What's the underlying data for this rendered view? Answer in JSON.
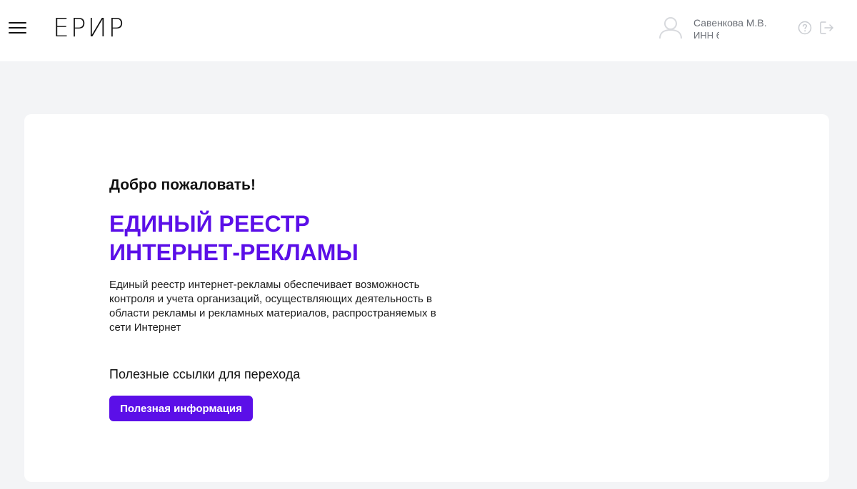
{
  "header": {
    "logo": "ЕРИР",
    "user": {
      "name": "Савенкова М.В.",
      "inn": "ИНН 6"
    },
    "icons": {
      "menu": "menu-icon",
      "avatar": "user-avatar-icon",
      "help": "help-circle-icon",
      "logout": "logout-icon"
    }
  },
  "main": {
    "welcome": "Добро пожаловать!",
    "title_line1": "ЕДИНЫЙ РЕЕСТР",
    "title_line2": "ИНТЕРНЕТ-РЕКЛАМЫ",
    "description": "Единый реестр интернет-рекламы обеспечивает возможность контроля и учета организаций, осуществляющих деятельность в области рекламы и рекламных материалов, распространяемых в сети Интернет",
    "links_heading": "Полезные ссылки для перехода",
    "useful_button": "Полезная информация"
  },
  "colors": {
    "accent": "#5b0fe8",
    "background": "#f3f4f6",
    "muted": "#6b6f76"
  }
}
